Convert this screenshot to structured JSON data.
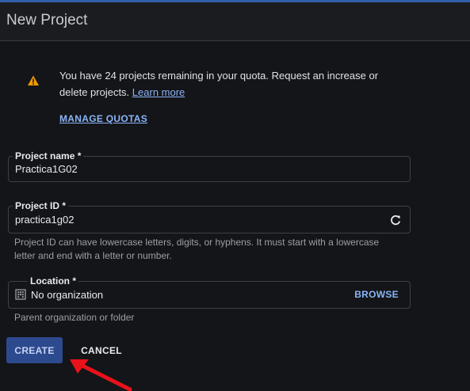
{
  "header": {
    "title": "New Project"
  },
  "quota": {
    "icon": "warning-icon",
    "message": "You have 24 projects remaining in your quota. Request an increase or delete projects.",
    "learn_more": "Learn more",
    "manage_label": "MANAGE QUOTAS"
  },
  "form": {
    "project_name": {
      "label": "Project name *",
      "value": "Practica1G02"
    },
    "project_id": {
      "label": "Project ID *",
      "value": "practica1g02",
      "hint": "Project ID can have lowercase letters, digits, or hyphens. It must start with a lowercase letter and end with a letter or number."
    },
    "location": {
      "label": "Location *",
      "value": "No organization",
      "browse_label": "BROWSE",
      "hint": "Parent organization or folder"
    }
  },
  "actions": {
    "create_label": "CREATE",
    "cancel_label": "CANCEL"
  },
  "colors": {
    "accent": "#8ab4f8",
    "warning": "#f29900",
    "primary_button": "#2e4a8e",
    "annotation_arrow": "#e8121b"
  }
}
